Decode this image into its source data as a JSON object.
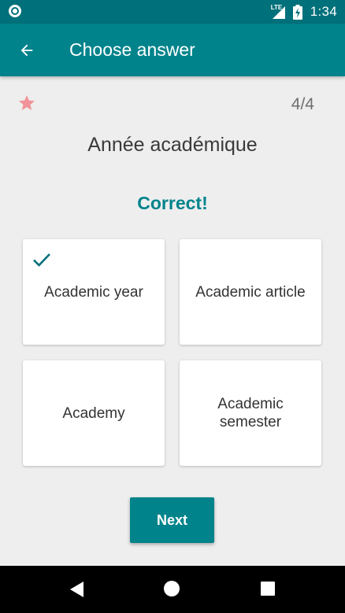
{
  "status_bar": {
    "network_label": "LTE",
    "time": "1:34"
  },
  "app_bar": {
    "title": "Choose answer",
    "back_icon": "arrow-back-icon"
  },
  "quiz": {
    "progress": "4/4",
    "question": "Année académique",
    "feedback": "Correct!",
    "feedback_color": "#00838b",
    "star_color": "#f2939a",
    "answers": [
      {
        "label": "Academic year",
        "selected": true
      },
      {
        "label": "Academic article",
        "selected": false
      },
      {
        "label": "Academy",
        "selected": false
      },
      {
        "label": "Academic semester",
        "selected": false
      }
    ],
    "next_label": "Next"
  },
  "theme": {
    "primary": "#00838b",
    "primary_dark": "#00707a",
    "background": "#eeeeee"
  },
  "nav_bar": {
    "icons": [
      "nav-back-icon",
      "nav-home-icon",
      "nav-recents-icon"
    ]
  }
}
